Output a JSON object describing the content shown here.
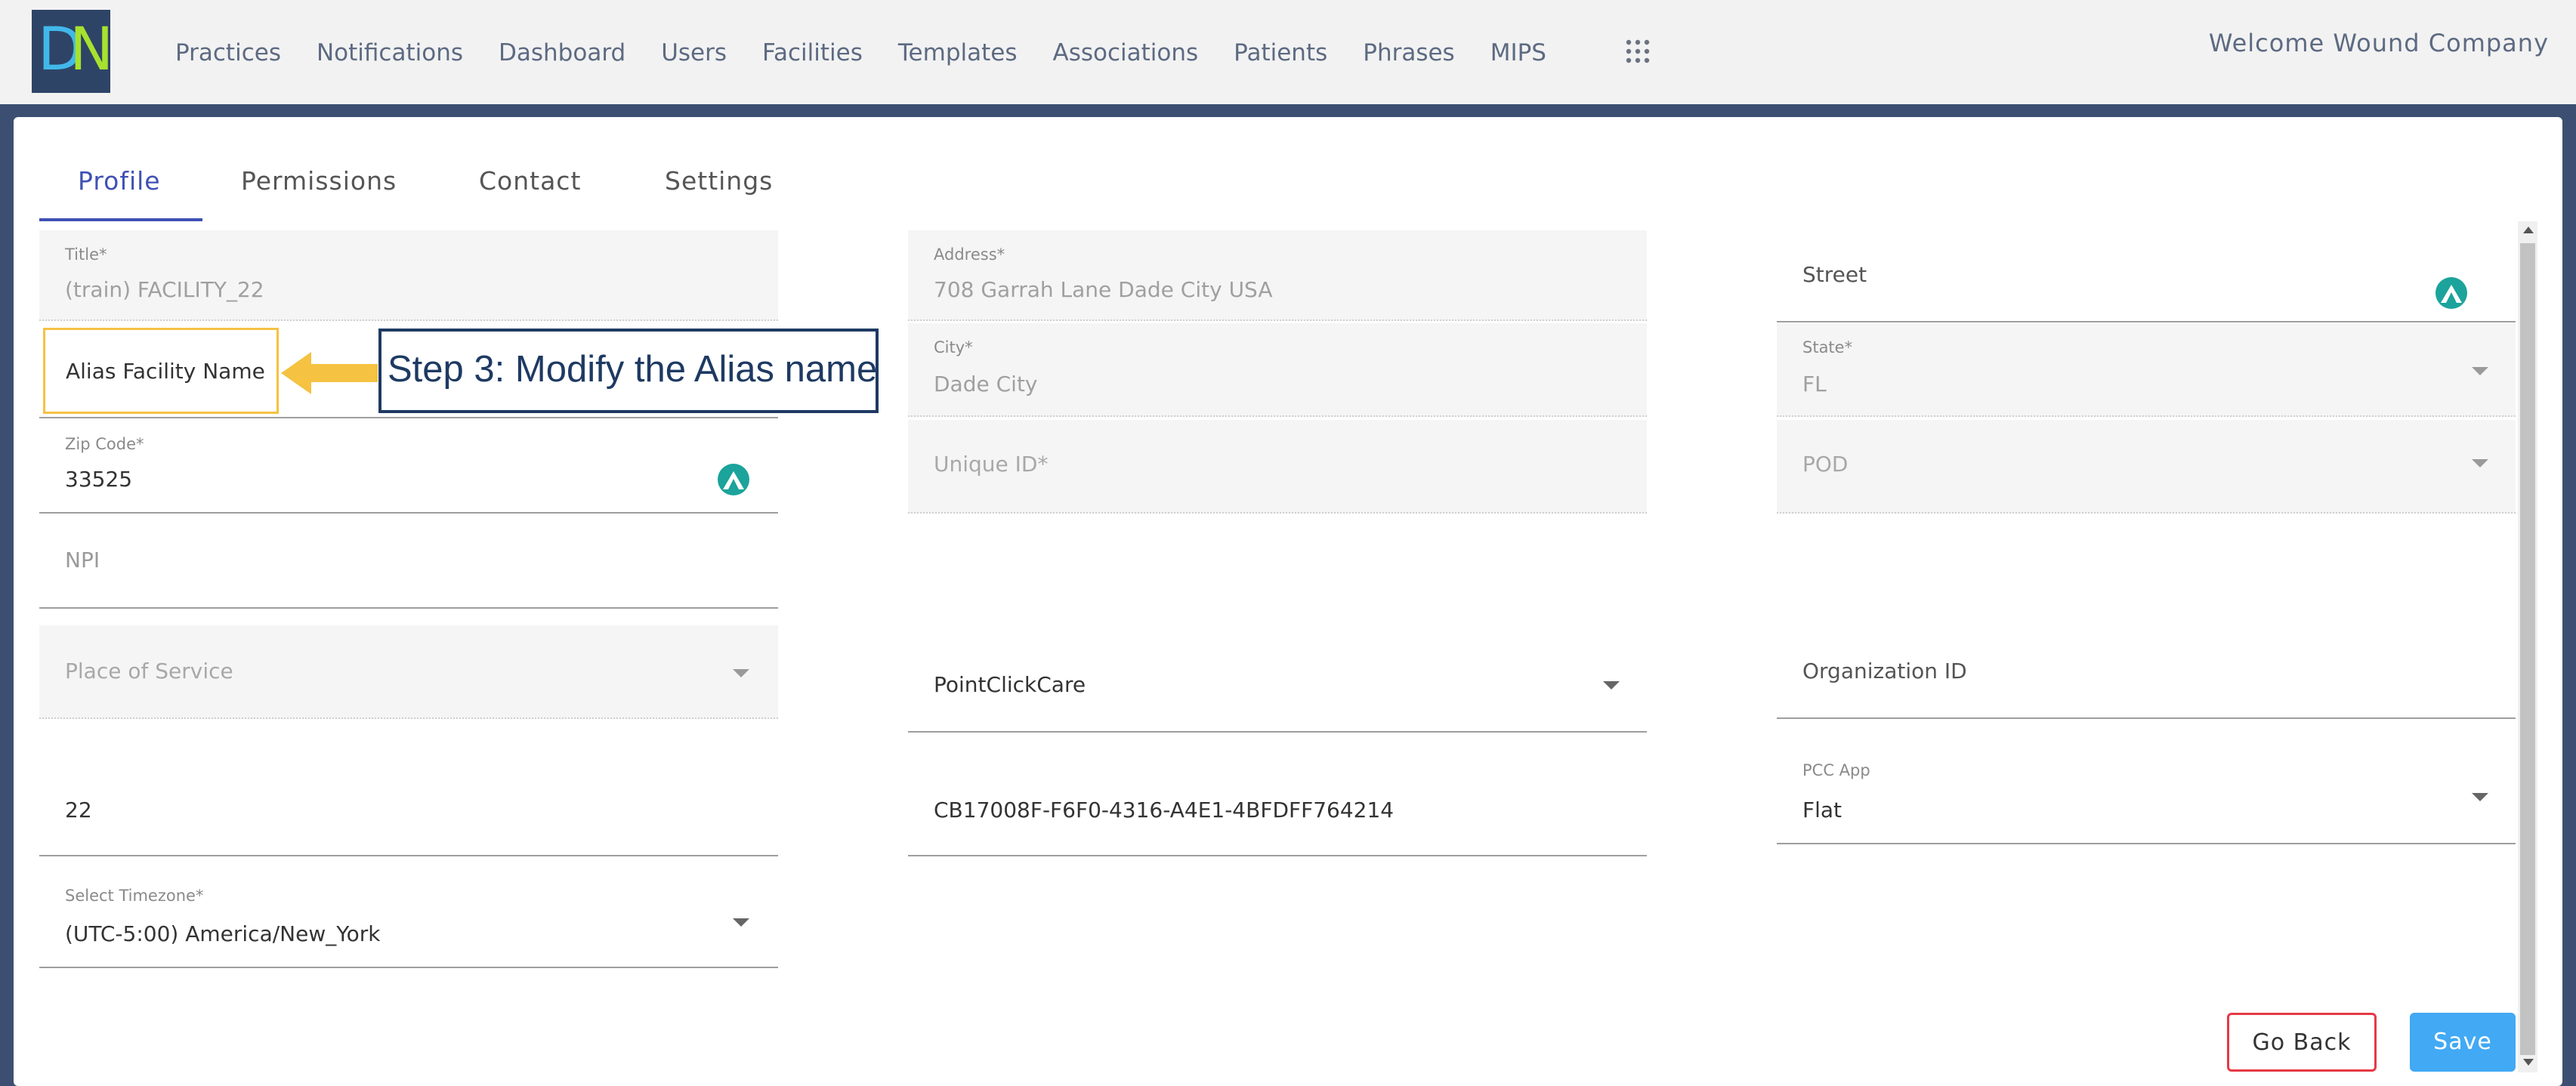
{
  "app": {
    "logo_letters": [
      "D",
      "N"
    ],
    "welcome": "Welcome Wound Company",
    "nav": [
      "Practices",
      "Notifications",
      "Dashboard",
      "Users",
      "Facilities",
      "Templates",
      "Associations",
      "Patients",
      "Phrases",
      "MIPS"
    ],
    "apps_icon": "grid-dots-icon"
  },
  "tabs": [
    {
      "label": "Profile",
      "active": true
    },
    {
      "label": "Permissions",
      "active": false
    },
    {
      "label": "Contact",
      "active": false
    },
    {
      "label": "Settings",
      "active": false
    }
  ],
  "form": {
    "title": {
      "label": "Title*",
      "value": "(train) FACILITY_22"
    },
    "alias": {
      "value": "Alias Facility Name"
    },
    "zip": {
      "label": "Zip Code*",
      "value": "33525"
    },
    "npi": {
      "placeholder": "NPI"
    },
    "place_of_service": {
      "placeholder": "Place of Service"
    },
    "pos_code": {
      "value": "22"
    },
    "timezone": {
      "label": "Select Timezone*",
      "value": "(UTC-5:00) America/New_York"
    },
    "address": {
      "label": "Address*",
      "value": "708 Garrah Lane Dade City USA"
    },
    "city": {
      "label": "City*",
      "value": "Dade City"
    },
    "unique_id": {
      "placeholder": "Unique ID*"
    },
    "ehr": {
      "value": "PointClickCare"
    },
    "facility_guid": {
      "value": "CB17008F-F6F0-4316-A4E1-4BFDFF764214"
    },
    "street": {
      "placeholder": "Street"
    },
    "state": {
      "label": "State*",
      "value": "FL"
    },
    "pod": {
      "placeholder": "POD"
    },
    "organization_id": {
      "placeholder": "Organization ID"
    },
    "pcc_app": {
      "label": "PCC App",
      "value": "Flat"
    }
  },
  "annotation": {
    "text": "Step 3: Modify the Alias name",
    "highlight_color": "#f5c242",
    "box_color": "#1e3a63"
  },
  "buttons": {
    "go_back": "Go Back",
    "save": "Save"
  },
  "colors": {
    "accent": "#3f51b5",
    "save": "#42a9f4",
    "back_border": "#e53945",
    "frame": "#3c4f72"
  }
}
